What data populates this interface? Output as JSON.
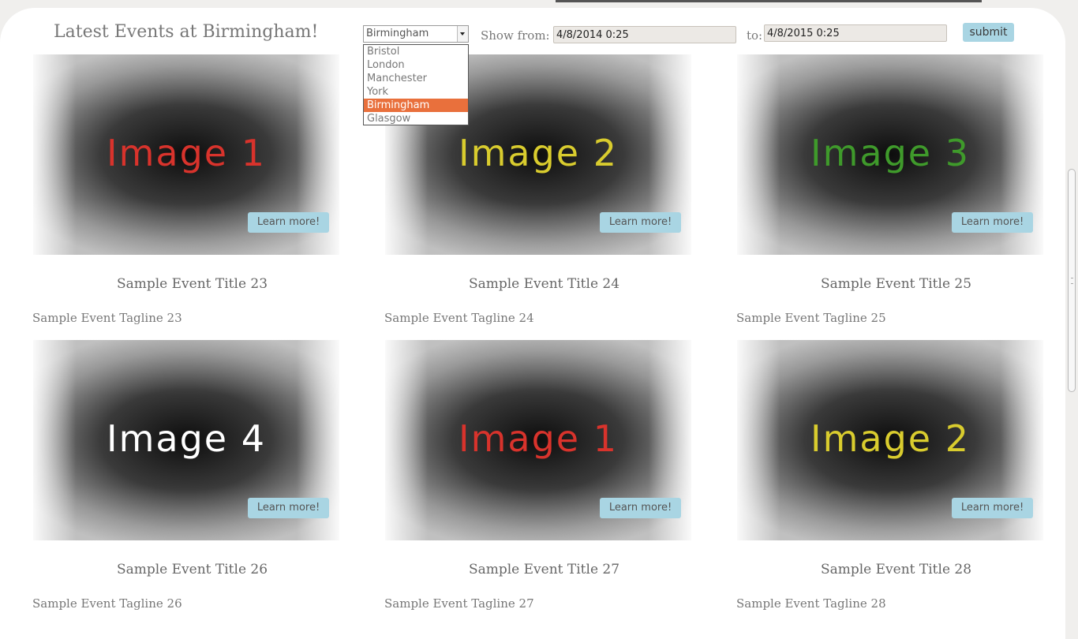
{
  "header": {
    "title": "Latest Events at Birmingham!",
    "city_select": {
      "value": "Birmingham",
      "options": [
        "Bristol",
        "London",
        "Manchester",
        "York",
        "Birmingham",
        "Glasgow"
      ],
      "highlighted_index": 4
    },
    "show_from_label": "Show from:",
    "from_value": "4/8/2014 0:25",
    "to_label": "to:",
    "to_value": "4/8/2015 0:25",
    "submit_label": "submit"
  },
  "events": [
    {
      "image_label": "Image 1",
      "image_color": "#d8332c",
      "button": "Learn more!",
      "title": "Sample Event Title 23",
      "tagline": "Sample Event Tagline 23"
    },
    {
      "image_label": "Image 2",
      "image_color": "#d9cc2e",
      "button": "Learn more!",
      "title": "Sample Event Title 24",
      "tagline": "Sample Event Tagline 24"
    },
    {
      "image_label": "Image 3",
      "image_color": "#3f9a2b",
      "button": "Learn more!",
      "title": "Sample Event Title 25",
      "tagline": "Sample Event Tagline 25"
    },
    {
      "image_label": "Image 4",
      "image_color": "#ffffff",
      "button": "Learn more!",
      "title": "Sample Event Title 26",
      "tagline": "Sample Event Tagline 26"
    },
    {
      "image_label": "Image 1",
      "image_color": "#d8332c",
      "button": "Learn more!",
      "title": "Sample Event Title 27",
      "tagline": "Sample Event Tagline 27"
    },
    {
      "image_label": "Image 2",
      "image_color": "#d9cc2e",
      "button": "Learn more!",
      "title": "Sample Event Title 28",
      "tagline": "Sample Event Tagline 28"
    }
  ],
  "colors": {
    "accent_button": "#a9d5e3",
    "dropdown_highlight": "#e9703c",
    "text": "#777777"
  }
}
